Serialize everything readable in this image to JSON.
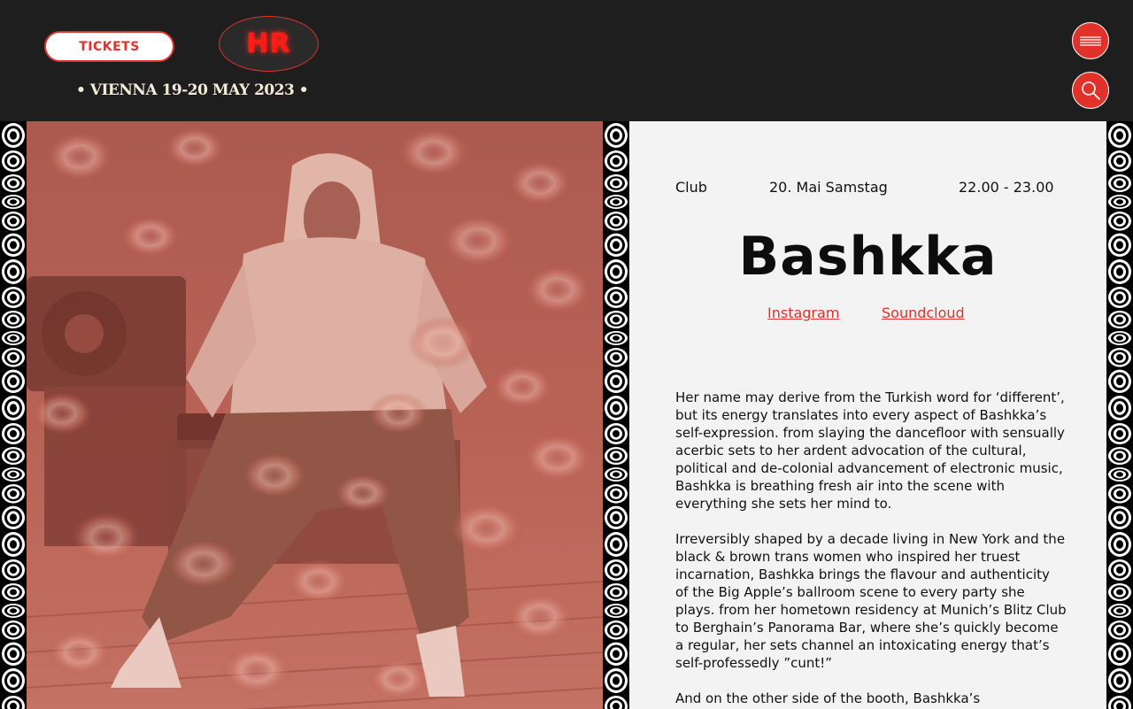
{
  "header": {
    "tickets_label": "TICKETS",
    "logo_text": "HR",
    "tagline": "• VIENNA 19-20 MAY 2023 •",
    "menu_icon": "hamburger-menu-icon",
    "search_icon": "search-icon"
  },
  "event": {
    "venue": "Club",
    "date": "20. Mai Samstag",
    "time": "22.00 - 23.00",
    "artist": "Bashkka",
    "links": [
      "Instagram",
      "Soundcloud"
    ],
    "bio": [
      "Her name may derive from the Turkish word for ‘different’, but its energy translates into every aspect of Bashkka’s self-expression. from slaying the dancefloor with sensually acerbic sets to her ardent advocation of the cultural, political and de-colonial advancement of electronic music, Bashkka is breathing fresh air into the scene with everything she sets her mind to.",
      "Irreversibly shaped by a decade living in New York and the black & brown trans women who inspired her truest incarnation, Bashkka brings the flavour and authenticity of the Big Apple’s ballroom scene to every party she plays. from her hometown residency at Munich’s Blitz Club to Berghain’s Panorama Bar, where she’s quickly become a regular, her sets channel an intoxicating energy that’s self-professedly ”cunt!”",
      "And on the other side of the booth, Bashkka’s"
    ]
  },
  "colors": {
    "accent": "#e0322a",
    "background_dark": "#1e1e1e",
    "panel_light": "#f3f3f3",
    "tagline": "#f4ead8"
  }
}
